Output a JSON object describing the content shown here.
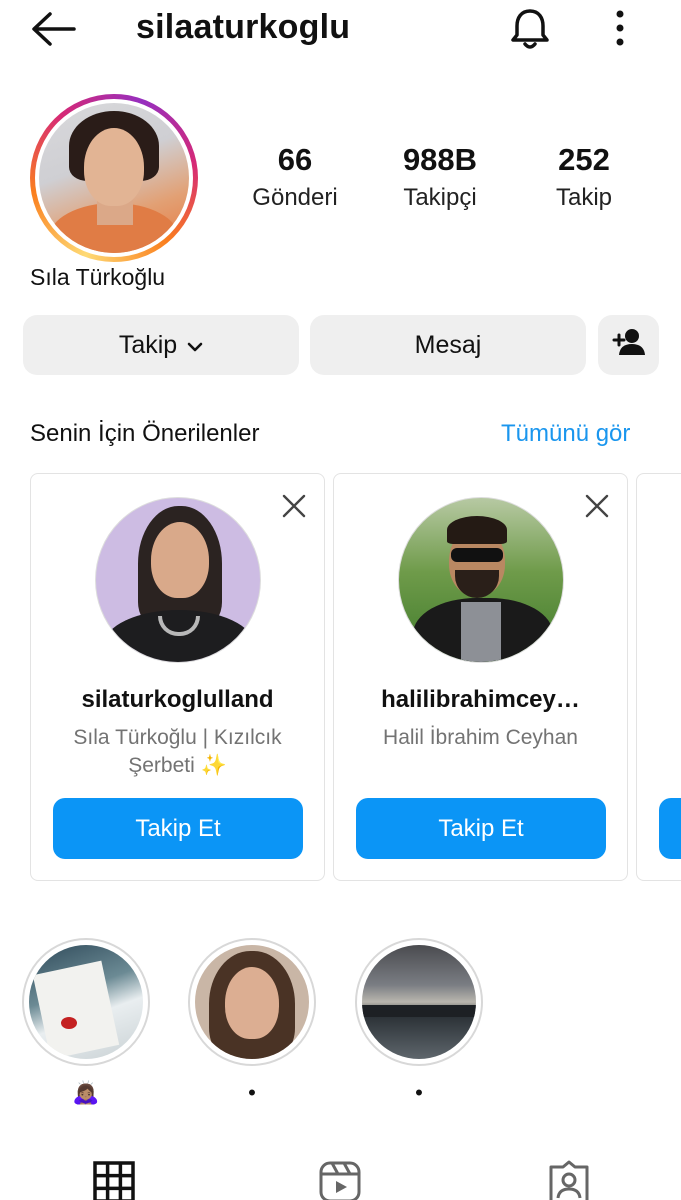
{
  "header": {
    "username": "silaaturkoglu",
    "icons": {
      "back": "arrow-left-icon",
      "notifications": "bell-icon",
      "more": "more-vertical-icon"
    }
  },
  "profile": {
    "full_name": "Sıla Türkoğlu",
    "stats": {
      "posts": {
        "value": "66",
        "label": "Gönderi"
      },
      "followers": {
        "value": "988B",
        "label": "Takipçi"
      },
      "following": {
        "value": "252",
        "label": "Takip"
      }
    }
  },
  "actions": {
    "follow_label": "Takip",
    "message_label": "Mesaj",
    "add_user_icon": "add-user-icon"
  },
  "suggestions": {
    "title": "Senin İçin Önerilenler",
    "see_all": "Tümünü gör",
    "cards": [
      {
        "username": "silaturkoglulland",
        "subtitle": "Sıla Türkoğlu | Kızılcık Şerbeti ✨",
        "button": "Takip Et"
      },
      {
        "username": "halilibrahimcey…",
        "subtitle": "Halil İbrahim Ceyhan",
        "button": "Takip Et"
      }
    ]
  },
  "highlights": [
    {
      "label": "🙇🏽‍♀️"
    },
    {
      "label": "•"
    },
    {
      "label": "•"
    }
  ],
  "tabs": [
    "grid-icon",
    "reels-icon",
    "tagged-icon"
  ],
  "colors": {
    "link": "#1a96ee",
    "primary_button": "#0b95f6",
    "gray_button": "#efefef"
  }
}
